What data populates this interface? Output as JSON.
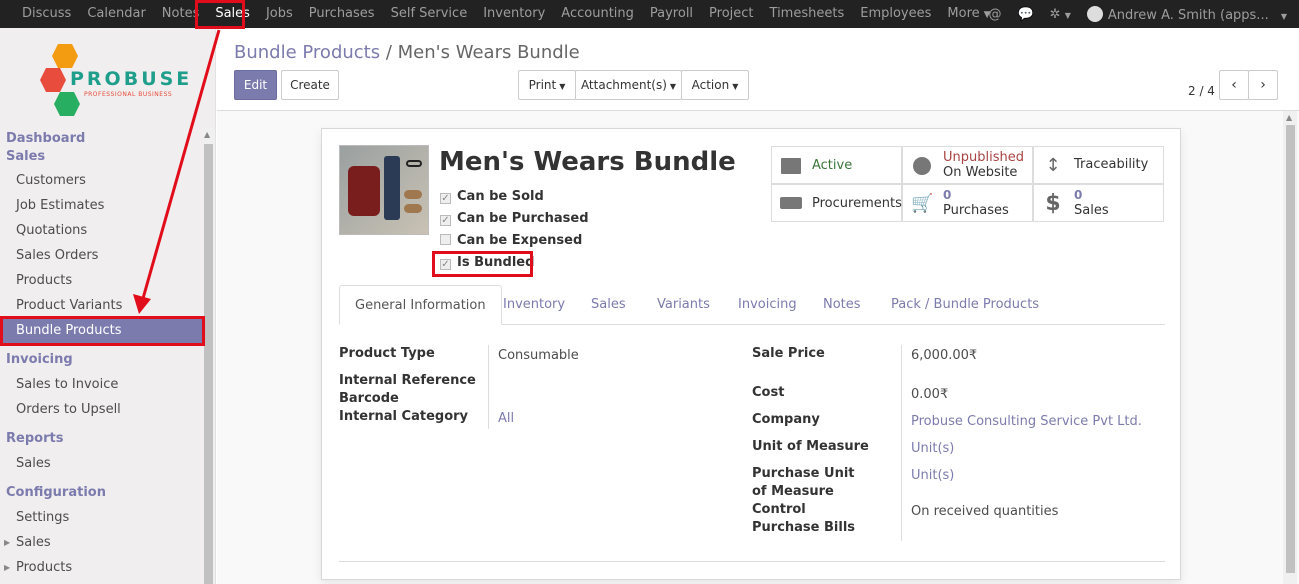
{
  "topbar": {
    "menu": [
      "Discuss",
      "Calendar",
      "Notes",
      "Sales",
      "Jobs",
      "Purchases",
      "Self Service",
      "Inventory",
      "Accounting",
      "Payroll",
      "Project",
      "Timesheets",
      "Employees",
      "More"
    ],
    "active_index": 3,
    "user": "Andrew A. Smith (apps..."
  },
  "logo": {
    "word": "PROBUSE",
    "sub": "PROFESSIONAL BUSINESS"
  },
  "sidebar": {
    "dashboard": "Dashboard",
    "sales_head": "Sales",
    "sales_items": [
      "Customers",
      "Job Estimates",
      "Quotations",
      "Sales Orders",
      "Products",
      "Product Variants",
      "Bundle Products"
    ],
    "invoicing_head": "Invoicing",
    "invoicing_items": [
      "Sales to Invoice",
      "Orders to Upsell"
    ],
    "reports_head": "Reports",
    "reports_items": [
      "Sales"
    ],
    "config_head": "Configuration",
    "config_items": [
      "Settings",
      "Sales",
      "Products"
    ]
  },
  "breadcrumb": {
    "parent": "Bundle Products",
    "sep": "/",
    "current": "Men's Wears Bundle"
  },
  "buttons": {
    "edit": "Edit",
    "create": "Create",
    "print": "Print",
    "attachments": "Attachment(s)",
    "action": "Action"
  },
  "pager": {
    "value": "2 / 4"
  },
  "product": {
    "name": "Men's Wears Bundle",
    "checkboxes": [
      {
        "label": "Can be Sold",
        "checked": true
      },
      {
        "label": "Can be Purchased",
        "checked": true
      },
      {
        "label": "Can be Expensed",
        "checked": false
      },
      {
        "label": "Is Bundled",
        "checked": true
      }
    ]
  },
  "smart_buttons": {
    "active": "Active",
    "unpublished": "Unpublished",
    "on_website": "On Website",
    "traceability": "Traceability",
    "procurements": "Procurements",
    "purchases_count": "0",
    "purchases": "Purchases",
    "sales_count": "0",
    "sales": "Sales"
  },
  "tabs": [
    "General Information",
    "Inventory",
    "Sales",
    "Variants",
    "Invoicing",
    "Notes",
    "Pack / Bundle Products"
  ],
  "fields_left": [
    {
      "label": "Product Type",
      "value": "Consumable"
    },
    {
      "label": "Internal Reference",
      "value": ""
    },
    {
      "label": "Barcode",
      "value": ""
    },
    {
      "label": "Internal Category",
      "value": "All"
    }
  ],
  "fields_right": [
    {
      "label": "Sale Price",
      "value": "6,000.00₹"
    },
    {
      "label": "Cost",
      "value": "0.00₹"
    },
    {
      "label": "Company",
      "value": "Probuse Consulting Service Pvt Ltd."
    },
    {
      "label": "Unit of Measure",
      "value": "Unit(s)"
    },
    {
      "label": "Purchase Unit of Measure",
      "value": "Unit(s)"
    },
    {
      "label": "Control Purchase Bills",
      "value": "On received quantities"
    }
  ],
  "colors": {
    "brand": "#7c7bad",
    "topbar": "#222222",
    "highlight": "#e20d1a",
    "active_green": "#3c763d",
    "unpublished_red": "#a94442"
  }
}
